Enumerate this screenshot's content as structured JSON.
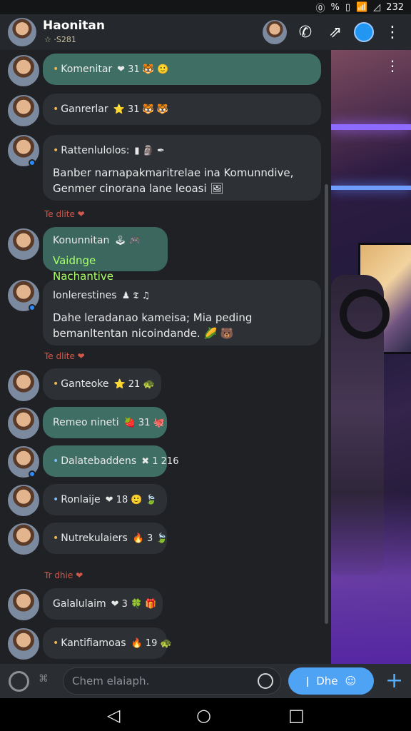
{
  "status_bar": {
    "time": "232",
    "icons": [
      "nfc-icon",
      "percent-icon",
      "battery-icon",
      "wifi-icon",
      "signal-icon"
    ]
  },
  "header": {
    "title": "Haonitan",
    "subtitle": "☆ ·S281",
    "icons": [
      "call-icon",
      "share-icon",
      "status-dot-icon",
      "more-icon"
    ]
  },
  "messages": [
    {
      "name": "Komenitar",
      "meta": "❤ 31 🐯 🙂",
      "text": ""
    },
    {
      "name": "Ganrerlar",
      "meta": "⭐ 31 🐯 🐯",
      "text": ""
    },
    {
      "name": "Rattenlulolos:",
      "meta": "▮ 🗿 ✒",
      "text": "Banber narnapakmaritrelae ina Komunndive, Genmer cinorana lane leoasi 🖼"
    },
    {
      "name": "Konunnitan",
      "meta": "🕹 🎮",
      "text": "Vaidnge Nachantive"
    },
    {
      "name": "Ionlerestines",
      "meta": "♟ 𝕿 ♫",
      "text": "Dahe leradanao kameisa; Mia peding bemanltentan nicoindande. 🌽 🐻"
    },
    {
      "name": "Ganteoke",
      "meta": "⭐ 21 🐢",
      "text": ""
    },
    {
      "name": "Remeo nineti",
      "meta": "🍓 31 🐙",
      "text": ""
    },
    {
      "name": "Dalatebaddens",
      "meta": "✖ 1 216",
      "text": ""
    },
    {
      "name": "Ronlaije",
      "meta": "❤ 18 🙂 🍃",
      "text": ""
    },
    {
      "name": "Nutrekulaiers",
      "meta": "🔥 3 🍃",
      "text": ""
    },
    {
      "name": "Galalulaim",
      "meta": "❤ 3 🍀 🎁",
      "text": ""
    },
    {
      "name": "Kantifiamoas",
      "meta": "🔥 19 🐢",
      "text": ""
    }
  ],
  "date_labels": [
    "Te dlite ❤",
    "Te dlite ❤",
    "Tr dhie ❤"
  ],
  "composer": {
    "placeholder": "Chem elaiaph.",
    "send_label": "Dhe"
  },
  "nav": {
    "back": "◁",
    "home": "○",
    "recent": "□"
  }
}
